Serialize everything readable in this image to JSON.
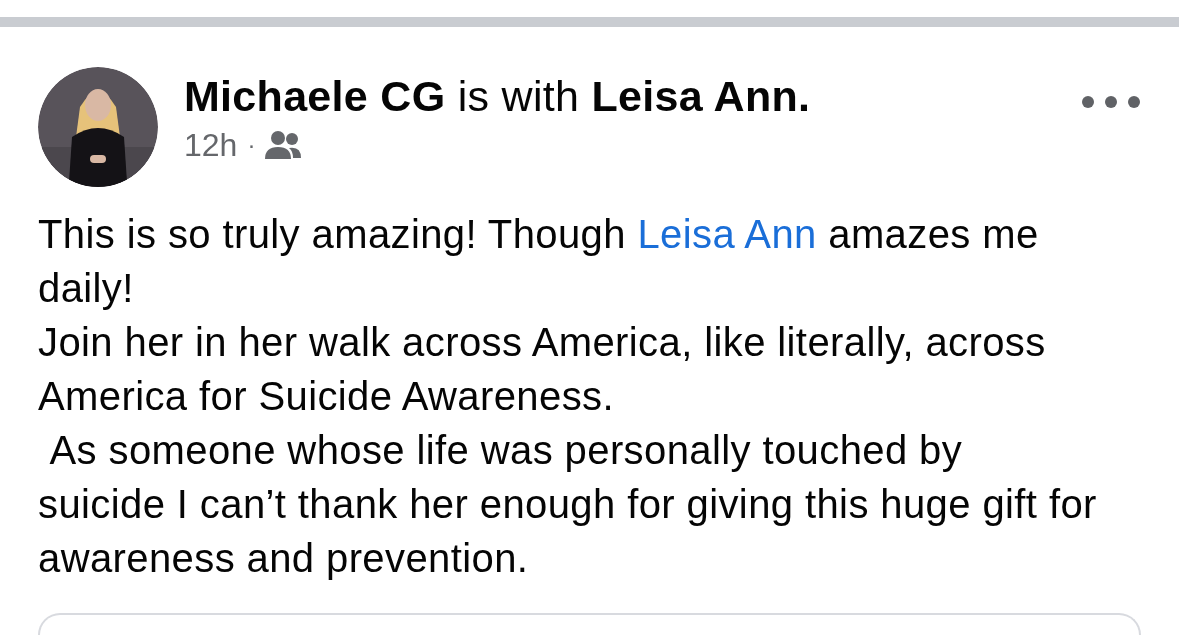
{
  "post": {
    "author": "Michaele CG",
    "connector": "is with",
    "tagged": "Leisa Ann.",
    "time": "12h",
    "separator": "·",
    "audience": {
      "kind": "friends"
    },
    "paragraphs": [
      {
        "parts": [
          {
            "kind": "text",
            "text": "This is so truly amazing! Though "
          },
          {
            "kind": "link",
            "text": "Leisa Ann"
          },
          {
            "kind": "text",
            "text": " amazes me daily!"
          }
        ]
      },
      {
        "parts": [
          {
            "kind": "text",
            "text": "Join her in her walk across America, like literally, across America for Suicide Awareness."
          }
        ]
      },
      {
        "parts": [
          {
            "kind": "text",
            "text": " As someone whose life was personally touched by suicide I can’t thank her enough for giving this huge gift for awareness and prevention."
          }
        ]
      }
    ]
  }
}
